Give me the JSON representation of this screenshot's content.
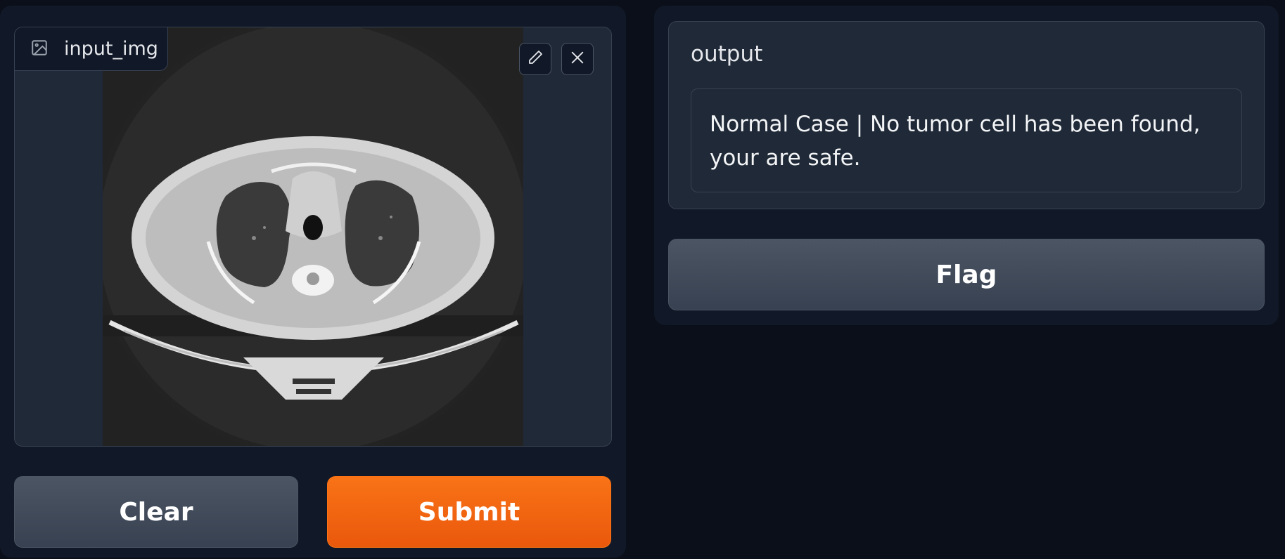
{
  "input": {
    "label": "input_img",
    "icons": [
      "image-icon",
      "pencil-icon",
      "close-icon"
    ]
  },
  "buttons": {
    "clear": "Clear",
    "submit": "Submit",
    "flag": "Flag"
  },
  "output": {
    "label": "output",
    "text": "Normal Case | No tumor cell has been found, your are safe."
  },
  "colors": {
    "background": "#0b0f19",
    "panel": "#111827",
    "block": "#1f2937",
    "accent": "#f97316",
    "secondary_button": "#4b5563"
  }
}
